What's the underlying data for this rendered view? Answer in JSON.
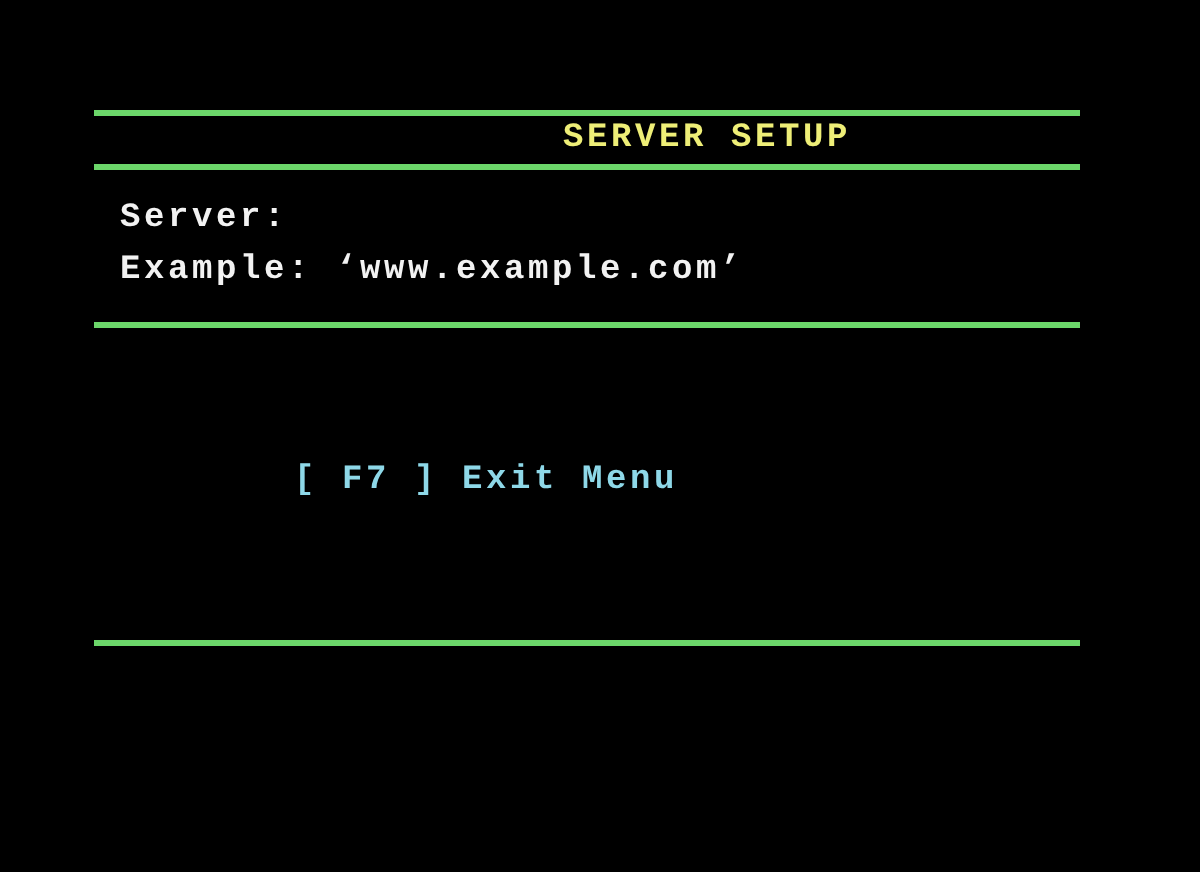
{
  "title": "SERVER SETUP",
  "fields": [
    {
      "label": "Server:"
    }
  ],
  "hint": "Example: ‘www.example.com’",
  "menu": [
    {
      "key": "[ F7 ]",
      "label": "Exit Menu"
    }
  ]
}
